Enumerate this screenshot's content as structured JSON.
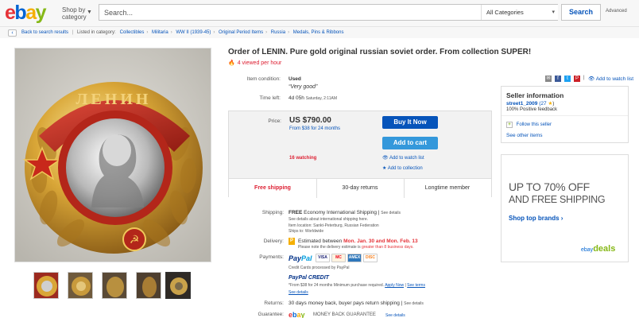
{
  "header": {
    "shop_by_line1": "Shop by",
    "shop_by_line2": "category",
    "search_placeholder": "Search...",
    "category_select": "All Categories",
    "search_button": "Search",
    "advanced": "Advanced"
  },
  "breadcrumb": {
    "back_link": "Back to search results",
    "listed_in": "Listed in category:",
    "items": [
      "Collectibles",
      "Militaria",
      "WW II (1939-45)",
      "Original Period Items",
      "Russia",
      "Medals, Pins & Ribbons"
    ]
  },
  "listing": {
    "title": "Order of LENIN. Pure gold original russian soviet order. From collection SUPER!",
    "viewed": "4 viewed per hour",
    "condition_label": "Item condition:",
    "condition_value": "Used",
    "condition_note": "“Very good”",
    "time_left_label": "Time left:",
    "time_left_value": "4d 05h",
    "time_left_detail": "Saturday, 2:11AM",
    "price_label": "Price:",
    "price": "US $790.00",
    "financing": "From $38 for 24 months",
    "buy_now": "Buy It Now",
    "add_to_cart": "Add to cart",
    "watching": "16 watching",
    "add_watch": "Add to watch list",
    "add_collection": "Add to collection",
    "free_shipping": "Free shipping",
    "returns_30": "30-day returns",
    "longtime": "Longtime member"
  },
  "details": {
    "shipping_label": "Shipping:",
    "shipping_free": "FREE",
    "shipping_text": "Economy International Shipping |",
    "shipping_see": "See details",
    "shipping_note": "See details about international shipping here.",
    "item_location": "Item location:  Sankt-Peterburg, Russian Federation",
    "ships_to": "Ships to:  Worldwide",
    "delivery_label": "Delivery:",
    "delivery_text": "Estimated between",
    "delivery_dates": "Mon. Jan. 30 and Mon. Feb. 13",
    "delivery_note1": "Please note the delivery estimate is",
    "delivery_note2": "greater than 8 business days.",
    "payments_label": "Payments:",
    "paypal_pay": "Pay",
    "paypal_pal": "Pal",
    "credit_cards": "Credit Cards processed by PayPal",
    "paypal_credit": "PayPal CREDIT",
    "credit_text": "*From $38 for 24 months  Minimum purchase required.",
    "apply_now": "Apply Now",
    "see_terms": "See terms",
    "see_details": "See details",
    "returns_label": "Returns:",
    "returns_text": "30 days money back, buyer pays return shipping |",
    "returns_see": "See details",
    "guarantee_label": "Guarantee:",
    "guarantee_text": "MONEY BACK GUARANTEE",
    "guarantee_see": "See details"
  },
  "share": {
    "watch": "Add to watch list"
  },
  "seller": {
    "heading": "Seller information",
    "name": "street1_2009",
    "score": "(27",
    "feedback": "100% Positive feedback",
    "follow": "Follow this seller",
    "other_items": "See other items"
  },
  "ad": {
    "line1": "UP TO 70% OFF",
    "line2": "AND FREE SHIPPING",
    "link": "Shop top brands ›",
    "brand_ebay": "ebay",
    "brand_deals": "deals"
  },
  "cards": [
    "VISA",
    "MC",
    "AMEX",
    "DISC"
  ],
  "colors": {
    "brand_blue": "#0654ba",
    "accent_red": "#dd1e31",
    "cart_blue": "#3498db"
  }
}
